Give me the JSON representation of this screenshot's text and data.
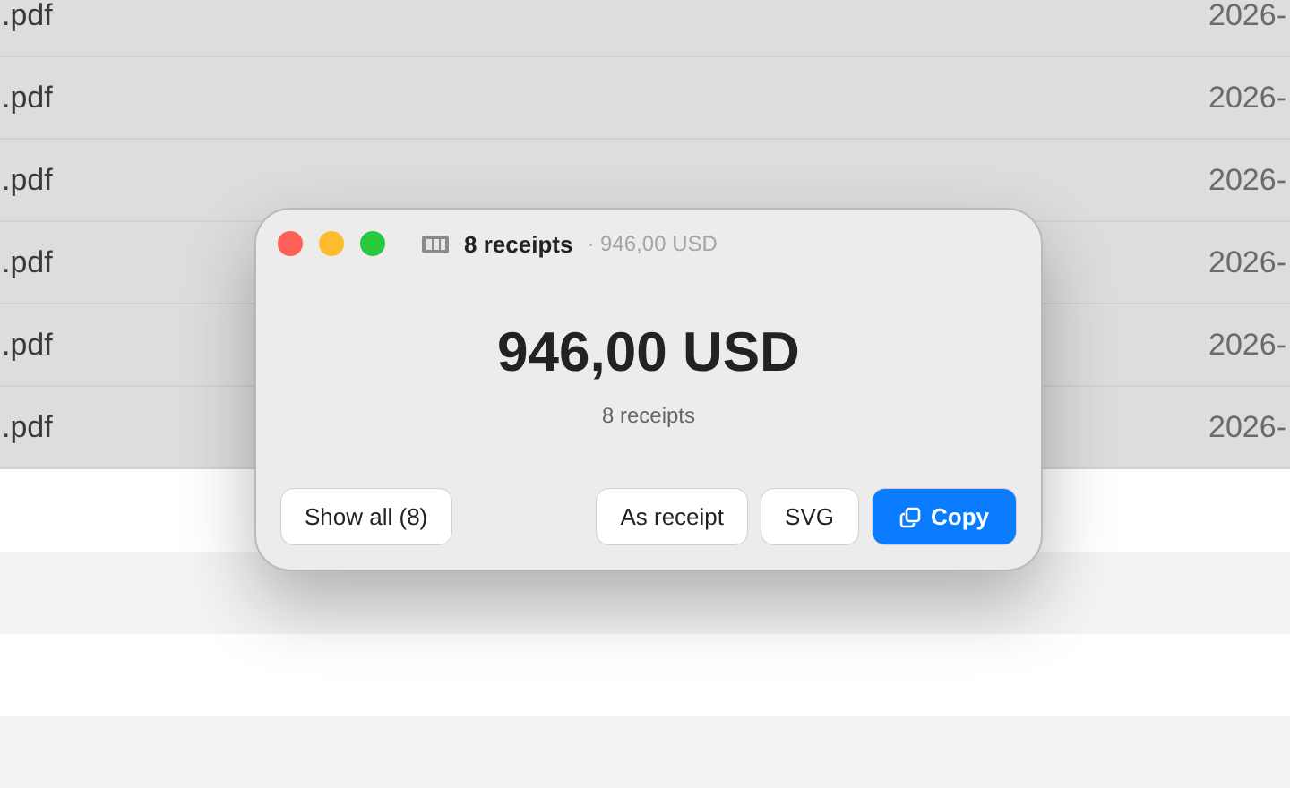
{
  "file_list": {
    "rows": [
      {
        "name": ".pdf",
        "date": "2026-"
      },
      {
        "name": ".pdf",
        "date": "2026-"
      },
      {
        "name": ".pdf",
        "date": "2026-"
      },
      {
        "name": ".pdf",
        "date": "2026-"
      },
      {
        "name": ".pdf",
        "date": "2026-"
      },
      {
        "name": ".pdf",
        "date": "2026-"
      }
    ]
  },
  "dialog": {
    "title": "8 receipts",
    "subtitle": "· 946,00 USD",
    "amount": "946,00 USD",
    "count": "8 receipts",
    "left_buttons": [
      {
        "label": "Show all (8)",
        "kind": "plain"
      }
    ],
    "right_buttons": [
      {
        "label": "As receipt",
        "kind": "plain"
      },
      {
        "label": "SVG",
        "kind": "plain"
      },
      {
        "label": "Copy",
        "kind": "primary"
      }
    ]
  }
}
